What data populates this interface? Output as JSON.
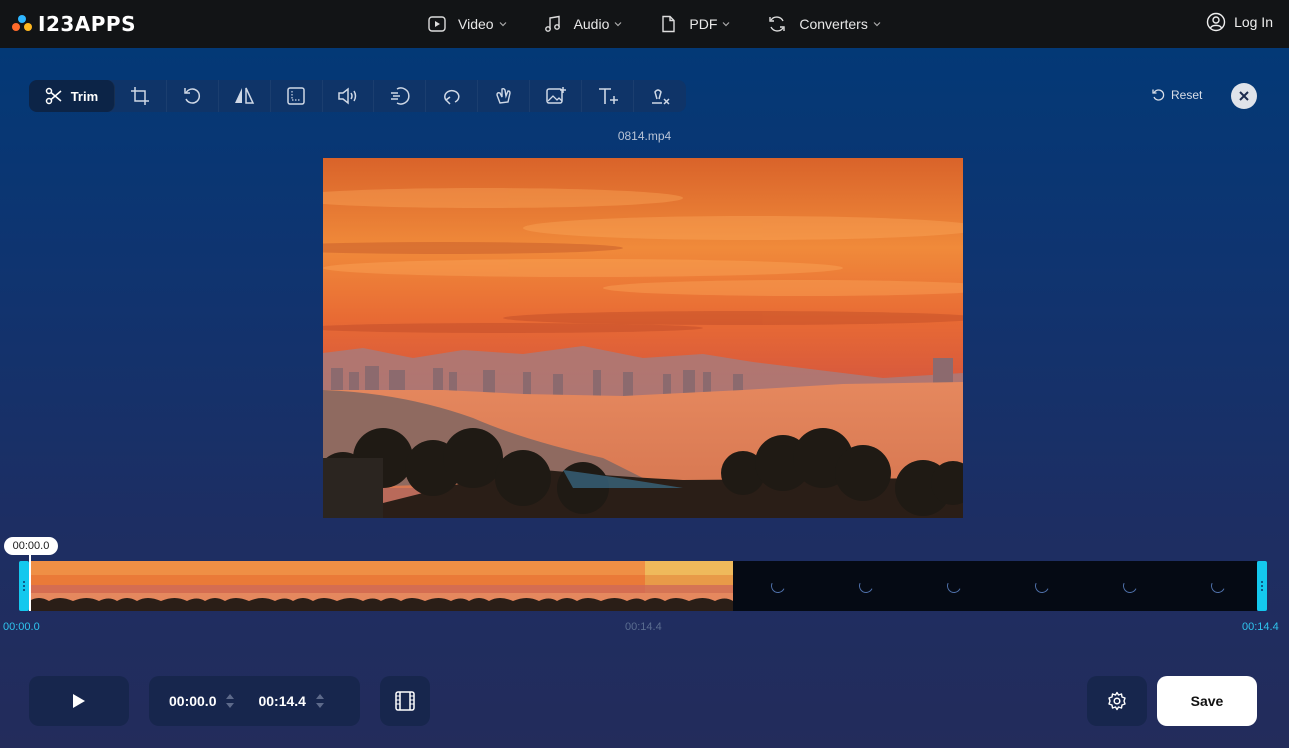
{
  "brand": {
    "name": "I23APPS",
    "dot_colors": [
      "#ff6a2b",
      "#2fb6ff",
      "#ffb820"
    ]
  },
  "nav": {
    "items": [
      {
        "label": "Video",
        "icon": "video-play-icon"
      },
      {
        "label": "Audio",
        "icon": "music-note-icon"
      },
      {
        "label": "PDF",
        "icon": "document-icon"
      },
      {
        "label": "Converters",
        "icon": "convert-cycle-icon"
      }
    ],
    "login_label": "Log In"
  },
  "toolbar": {
    "active_tool": "Trim",
    "tools": [
      "trim-icon",
      "crop-icon",
      "rotate-icon",
      "flip-icon",
      "resize-icon",
      "volume-icon",
      "speed-icon",
      "loop-icon",
      "stabilize-icon",
      "add-image-icon",
      "add-text-icon",
      "remove-logo-icon"
    ],
    "reset_label": "Reset"
  },
  "file": {
    "name": "0814.mp4"
  },
  "timeline": {
    "playhead_time": "00:00.0",
    "start_label": "00:00.0",
    "mid_label": "00:14.4",
    "end_label": "00:14.4",
    "loaded_thumbs": 8,
    "loading_thumbs": 6,
    "accent_color": "#14c8ee"
  },
  "controls": {
    "start_time": "00:00.0",
    "end_time": "00:14.4",
    "save_label": "Save"
  }
}
